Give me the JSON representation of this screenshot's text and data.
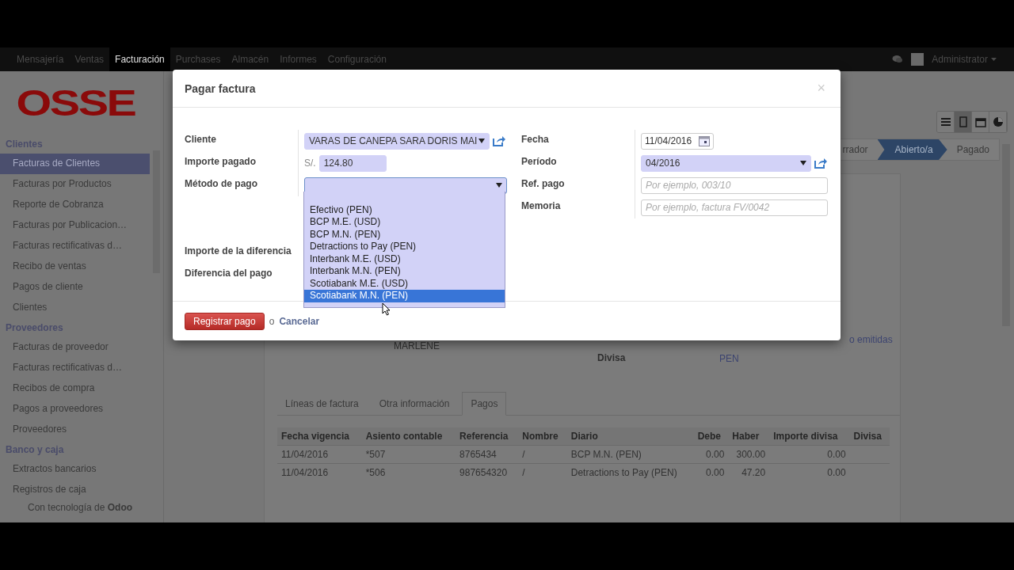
{
  "navbar": {
    "menu": [
      {
        "label": "Mensajería",
        "selected": false
      },
      {
        "label": "Ventas",
        "selected": false
      },
      {
        "label": "Facturación",
        "selected": true
      },
      {
        "label": "Purchases",
        "selected": false
      },
      {
        "label": "Almacén",
        "selected": false
      },
      {
        "label": "Informes",
        "selected": false
      },
      {
        "label": "Configuración",
        "selected": false
      }
    ],
    "user": "Administrator"
  },
  "sidebar": {
    "logo": "OSSE",
    "sections": [
      {
        "title": "Clientes",
        "items": [
          {
            "label": "Facturas de Clientes",
            "selected": true
          },
          {
            "label": "Facturas por Productos",
            "selected": false
          },
          {
            "label": "Reporte de Cobranza",
            "selected": false
          },
          {
            "label": "Facturas por Publicacion…",
            "selected": false
          },
          {
            "label": "Facturas rectificativas d…",
            "selected": false
          },
          {
            "label": "Recibo de ventas",
            "selected": false
          },
          {
            "label": "Pagos de cliente",
            "selected": false
          },
          {
            "label": "Clientes",
            "selected": false
          }
        ]
      },
      {
        "title": "Proveedores",
        "items": [
          {
            "label": "Facturas de proveedor",
            "selected": false
          },
          {
            "label": "Facturas rectificativas d…",
            "selected": false
          },
          {
            "label": "Recibos de compra",
            "selected": false
          },
          {
            "label": "Pagos a proveedores",
            "selected": false
          },
          {
            "label": "Proveedores",
            "selected": false
          }
        ]
      },
      {
        "title": "Banco y caja",
        "items": [
          {
            "label": "Extractos bancarios",
            "selected": false
          },
          {
            "label": "Registros de caja",
            "selected": false
          }
        ]
      }
    ],
    "footer": "Con tecnología de **Odoo**"
  },
  "view_switcher": [
    {
      "kind": "list",
      "selected": false
    },
    {
      "kind": "form",
      "selected": true
    },
    {
      "kind": "calendar",
      "selected": false
    },
    {
      "kind": "graph",
      "selected": false
    }
  ],
  "statusbar": [
    {
      "label": "rrador",
      "selected": false
    },
    {
      "label": "Abierto/a",
      "selected": true
    },
    {
      "label": "Pagado",
      "selected": false
    }
  ],
  "sheet": {
    "partner_rest": "MARLENE",
    "note_rest": "o emitidas",
    "currency_label": "Divisa",
    "currency_value": "PEN"
  },
  "tabs": [
    {
      "label": "Líneas de factura",
      "selected": false
    },
    {
      "label": "Otra información",
      "selected": false
    },
    {
      "label": "Pagos",
      "selected": true
    }
  ],
  "payments": {
    "columns": [
      "Fecha vigencia",
      "Asiento contable",
      "Referencia",
      "Nombre",
      "Diario",
      "Debe",
      "Haber",
      "Importe divisa",
      "Divisa"
    ],
    "rows": [
      [
        "11/04/2016",
        "*507",
        "8765434",
        "/",
        "BCP M.N. (PEN)",
        "0.00",
        "300.00",
        "0.00",
        ""
      ],
      [
        "11/04/2016",
        "*506",
        "987654320",
        "/",
        "Detractions to Pay (PEN)",
        "0.00",
        "47.20",
        "0.00",
        ""
      ]
    ]
  },
  "dialog": {
    "title": "Pagar factura",
    "close": "×",
    "cliente": {
      "label": "Cliente",
      "value": "VARAS DE CANEPA SARA DORIS MAI"
    },
    "importe": {
      "label": "Importe pagado",
      "currency": "S/.",
      "value": "124.80"
    },
    "metodo": {
      "label": "Método de pago",
      "options": [
        {
          "label": "Efectivo (PEN)",
          "selected": false
        },
        {
          "label": "BCP M.E. (USD)",
          "selected": false
        },
        {
          "label": "BCP M.N. (PEN)",
          "selected": false
        },
        {
          "label": "Detractions to Pay (PEN)",
          "selected": false
        },
        {
          "label": "Interbank M.E. (USD)",
          "selected": false
        },
        {
          "label": "Interbank M.N. (PEN)",
          "selected": false
        },
        {
          "label": "Scotiabank M.E. (USD)",
          "selected": false
        },
        {
          "label": "Scotiabank M.N. (PEN)",
          "selected": true
        }
      ]
    },
    "diff_labels": [
      "Importe de la diferencia",
      "Diferencia del pago"
    ],
    "fecha": {
      "label": "Fecha",
      "value": "11/04/2016"
    },
    "periodo": {
      "label": "Período",
      "value": "04/2016"
    },
    "ref": {
      "label": "Ref. pago",
      "placeholder": "Por ejemplo, 003/10"
    },
    "memoria": {
      "label": "Memoria",
      "placeholder": "Por ejemplo, factura FV/0042"
    },
    "submit": "Registrar pago",
    "or": "o",
    "cancel": "Cancelar"
  }
}
